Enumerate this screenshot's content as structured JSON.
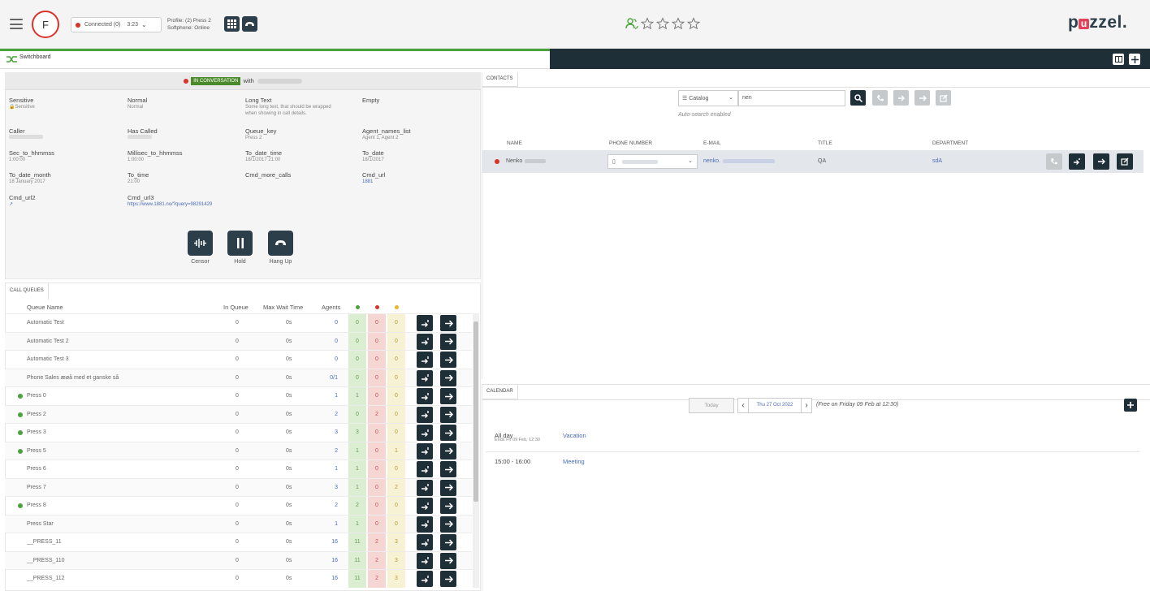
{
  "topbar": {
    "avatar_letter": "F",
    "status_label": "Connected (0)",
    "status_time": "3:23",
    "profile_line1": "Profile: (2) Press 2",
    "profile_line2": "Softphone: Online",
    "logo_pre": "p",
    "logo_u": "u",
    "logo_post": "zzel."
  },
  "tabs": {
    "switchboard": "Switchboard"
  },
  "conversation": {
    "badge": "IN CONVERSATION",
    "with": "with"
  },
  "details": [
    {
      "key": "Sensitive",
      "value": "Sensitive"
    },
    {
      "key": "Normal",
      "value": "Normal"
    },
    {
      "key": "Long Text",
      "value": "Some long text, that should be wrapped when showing in call details."
    },
    {
      "key": "Empty",
      "value": ""
    },
    {
      "key": "Caller",
      "value": ""
    },
    {
      "key": "Has Called",
      "value": ""
    },
    {
      "key": "Queue_key",
      "value": "Press 2"
    },
    {
      "key": "Agent_names_list",
      "value": "Agent 1, Agent 2"
    },
    {
      "key": "Sec_to_hhmmss",
      "value": "1:00:00"
    },
    {
      "key": "Millisec_to_hhmmss",
      "value": "1:00:00"
    },
    {
      "key": "To_date_time",
      "value": "18/1/2017 21:00"
    },
    {
      "key": "To_date",
      "value": "18/1/2017"
    },
    {
      "key": "To_date_month",
      "value": "18 January 2017"
    },
    {
      "key": "To_time",
      "value": "21:00"
    },
    {
      "key": "Cmd_more_calls",
      "value": ""
    },
    {
      "key": "Cmd_url",
      "value": "1881"
    },
    {
      "key": "Cmd_url2",
      "value": ""
    },
    {
      "key": "Cmd_url3",
      "value": "https://www.1881.no/?query=98291429"
    }
  ],
  "actions": {
    "censor": "Censor",
    "hold": "Hold",
    "hangup": "Hang Up"
  },
  "call_queues": {
    "tab": "CALL QUEUES",
    "headers": {
      "name": "Queue Name",
      "in_queue": "In Queue",
      "max_wait": "Max Wait Time",
      "agents": "Agents"
    },
    "rows": [
      {
        "name": "Automatic Test",
        "dot": false,
        "inq": "0",
        "wait": "0s",
        "agents": "0",
        "g": "0",
        "r": "0",
        "y": "0"
      },
      {
        "name": "Automatic Test 2",
        "dot": false,
        "inq": "0",
        "wait": "0s",
        "agents": "0",
        "g": "0",
        "r": "0",
        "y": "0"
      },
      {
        "name": "Automatic Test 3",
        "dot": false,
        "inq": "0",
        "wait": "0s",
        "agents": "0",
        "g": "0",
        "r": "0",
        "y": "0"
      },
      {
        "name": "Phone Sales æøå med et ganske så",
        "dot": false,
        "inq": "0",
        "wait": "0s",
        "agents": "0/1",
        "g": "0",
        "r": "0",
        "y": "0"
      },
      {
        "name": "Press 0",
        "dot": true,
        "inq": "0",
        "wait": "0s",
        "agents": "1",
        "g": "1",
        "r": "0",
        "y": "0"
      },
      {
        "name": "Press 2",
        "dot": true,
        "inq": "0",
        "wait": "0s",
        "agents": "2",
        "g": "0",
        "r": "2",
        "y": "0"
      },
      {
        "name": "Press 3",
        "dot": true,
        "inq": "0",
        "wait": "0s",
        "agents": "3",
        "g": "3",
        "r": "0",
        "y": "0"
      },
      {
        "name": "Press 5",
        "dot": true,
        "inq": "0",
        "wait": "0s",
        "agents": "2",
        "g": "1",
        "r": "0",
        "y": "1"
      },
      {
        "name": "Press 6",
        "dot": false,
        "inq": "0",
        "wait": "0s",
        "agents": "1",
        "g": "1",
        "r": "0",
        "y": "0"
      },
      {
        "name": "Press 7",
        "dot": false,
        "inq": "0",
        "wait": "0s",
        "agents": "3",
        "g": "1",
        "r": "0",
        "y": "2"
      },
      {
        "name": "Press 8",
        "dot": true,
        "inq": "0",
        "wait": "0s",
        "agents": "2",
        "g": "2",
        "r": "0",
        "y": "0"
      },
      {
        "name": "Press Star",
        "dot": false,
        "inq": "0",
        "wait": "0s",
        "agents": "1",
        "g": "1",
        "r": "0",
        "y": "0"
      },
      {
        "name": "__PRESS_11",
        "dot": false,
        "inq": "0",
        "wait": "0s",
        "agents": "16",
        "g": "11",
        "r": "2",
        "y": "3"
      },
      {
        "name": "__PRESS_110",
        "dot": false,
        "inq": "0",
        "wait": "0s",
        "agents": "16",
        "g": "11",
        "r": "2",
        "y": "3"
      },
      {
        "name": "__PRESS_112",
        "dot": false,
        "inq": "0",
        "wait": "0s",
        "agents": "16",
        "g": "11",
        "r": "2",
        "y": "3"
      }
    ]
  },
  "contacts": {
    "tab": "CONTACTS",
    "catalog": "Catalog",
    "search_value": "nen",
    "auto_search": "Auto-search enabled",
    "headers": {
      "name": "NAME",
      "phone": "PHONE NUMBER",
      "email": "E-MAIL",
      "title": "TITLE",
      "department": "DEPARTMENT"
    },
    "row": {
      "name": "Nenko",
      "email": "nenko.",
      "title": "QA",
      "department": "sdA"
    }
  },
  "calendar": {
    "tab": "CALENDAR",
    "today": "Today",
    "date": "Thu 27 Oct 2022",
    "free": "(Free on Friday 09 Feb at 12:30)",
    "events": [
      {
        "time": "All day",
        "sub": "Ends Fri 09 Feb, 12:30",
        "name": "Vacation"
      },
      {
        "time": "15:00 - 16:00",
        "sub": "",
        "name": "Meeting"
      }
    ]
  },
  "colors": {
    "accent_green": "#4aa33c",
    "dark": "#1f2f38",
    "red": "#d9342b",
    "brand": "#e0445b"
  }
}
